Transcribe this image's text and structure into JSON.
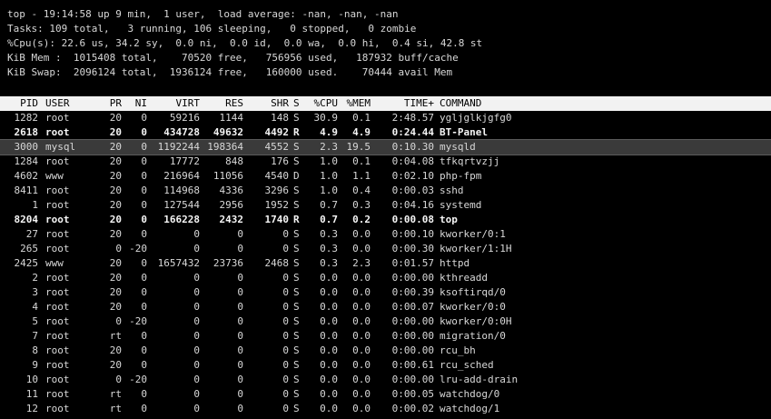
{
  "summary": {
    "line1": "top - 19:14:58 up 9 min,  1 user,  load average: -nan, -nan, -nan",
    "line2": "Tasks: 109 total,   3 running, 106 sleeping,   0 stopped,   0 zombie",
    "line3": "%Cpu(s): 22.6 us, 34.2 sy,  0.0 ni,  0.0 id,  0.0 wa,  0.0 hi,  0.4 si, 42.8 st",
    "line4": "KiB Mem :  1015408 total,    70520 free,   756956 used,   187932 buff/cache",
    "line5": "KiB Swap:  2096124 total,  1936124 free,   160000 used.    70444 avail Mem"
  },
  "columns": {
    "pid": "PID",
    "user": "USER",
    "pr": "PR",
    "ni": "NI",
    "virt": "VIRT",
    "res": "RES",
    "shr": "SHR",
    "s": "S",
    "cpu": "%CPU",
    "mem": "%MEM",
    "time": "TIME+",
    "command": "COMMAND"
  },
  "processes": [
    {
      "pid": "1282",
      "user": "root",
      "pr": "20",
      "ni": "0",
      "virt": "59216",
      "res": "1144",
      "shr": "148",
      "s": "S",
      "cpu": "30.9",
      "mem": "0.1",
      "time": "2:48.57",
      "command": "ygljglkjgfg0",
      "bold": false,
      "selected": false
    },
    {
      "pid": "2618",
      "user": "root",
      "pr": "20",
      "ni": "0",
      "virt": "434728",
      "res": "49632",
      "shr": "4492",
      "s": "R",
      "cpu": "4.9",
      "mem": "4.9",
      "time": "0:24.44",
      "command": "BT-Panel",
      "bold": true,
      "selected": false
    },
    {
      "pid": "3000",
      "user": "mysql",
      "pr": "20",
      "ni": "0",
      "virt": "1192244",
      "res": "198364",
      "shr": "4552",
      "s": "S",
      "cpu": "2.3",
      "mem": "19.5",
      "time": "0:10.30",
      "command": "mysqld",
      "bold": false,
      "selected": true
    },
    {
      "pid": "1284",
      "user": "root",
      "pr": "20",
      "ni": "0",
      "virt": "17772",
      "res": "848",
      "shr": "176",
      "s": "S",
      "cpu": "1.0",
      "mem": "0.1",
      "time": "0:04.08",
      "command": "tfkqrtvzjj",
      "bold": false,
      "selected": false
    },
    {
      "pid": "4602",
      "user": "www",
      "pr": "20",
      "ni": "0",
      "virt": "216964",
      "res": "11056",
      "shr": "4540",
      "s": "D",
      "cpu": "1.0",
      "mem": "1.1",
      "time": "0:02.10",
      "command": "php-fpm",
      "bold": false,
      "selected": false
    },
    {
      "pid": "8411",
      "user": "root",
      "pr": "20",
      "ni": "0",
      "virt": "114968",
      "res": "4336",
      "shr": "3296",
      "s": "S",
      "cpu": "1.0",
      "mem": "0.4",
      "time": "0:00.03",
      "command": "sshd",
      "bold": false,
      "selected": false
    },
    {
      "pid": "1",
      "user": "root",
      "pr": "20",
      "ni": "0",
      "virt": "127544",
      "res": "2956",
      "shr": "1952",
      "s": "S",
      "cpu": "0.7",
      "mem": "0.3",
      "time": "0:04.16",
      "command": "systemd",
      "bold": false,
      "selected": false
    },
    {
      "pid": "8204",
      "user": "root",
      "pr": "20",
      "ni": "0",
      "virt": "166228",
      "res": "2432",
      "shr": "1740",
      "s": "R",
      "cpu": "0.7",
      "mem": "0.2",
      "time": "0:00.08",
      "command": "top",
      "bold": true,
      "selected": false
    },
    {
      "pid": "27",
      "user": "root",
      "pr": "20",
      "ni": "0",
      "virt": "0",
      "res": "0",
      "shr": "0",
      "s": "S",
      "cpu": "0.3",
      "mem": "0.0",
      "time": "0:00.10",
      "command": "kworker/0:1",
      "bold": false,
      "selected": false
    },
    {
      "pid": "265",
      "user": "root",
      "pr": "0",
      "ni": "-20",
      "virt": "0",
      "res": "0",
      "shr": "0",
      "s": "S",
      "cpu": "0.3",
      "mem": "0.0",
      "time": "0:00.30",
      "command": "kworker/1:1H",
      "bold": false,
      "selected": false
    },
    {
      "pid": "2425",
      "user": "www",
      "pr": "20",
      "ni": "0",
      "virt": "1657432",
      "res": "23736",
      "shr": "2468",
      "s": "S",
      "cpu": "0.3",
      "mem": "2.3",
      "time": "0:01.57",
      "command": "httpd",
      "bold": false,
      "selected": false
    },
    {
      "pid": "2",
      "user": "root",
      "pr": "20",
      "ni": "0",
      "virt": "0",
      "res": "0",
      "shr": "0",
      "s": "S",
      "cpu": "0.0",
      "mem": "0.0",
      "time": "0:00.00",
      "command": "kthreadd",
      "bold": false,
      "selected": false
    },
    {
      "pid": "3",
      "user": "root",
      "pr": "20",
      "ni": "0",
      "virt": "0",
      "res": "0",
      "shr": "0",
      "s": "S",
      "cpu": "0.0",
      "mem": "0.0",
      "time": "0:00.39",
      "command": "ksoftirqd/0",
      "bold": false,
      "selected": false
    },
    {
      "pid": "4",
      "user": "root",
      "pr": "20",
      "ni": "0",
      "virt": "0",
      "res": "0",
      "shr": "0",
      "s": "S",
      "cpu": "0.0",
      "mem": "0.0",
      "time": "0:00.07",
      "command": "kworker/0:0",
      "bold": false,
      "selected": false
    },
    {
      "pid": "5",
      "user": "root",
      "pr": "0",
      "ni": "-20",
      "virt": "0",
      "res": "0",
      "shr": "0",
      "s": "S",
      "cpu": "0.0",
      "mem": "0.0",
      "time": "0:00.00",
      "command": "kworker/0:0H",
      "bold": false,
      "selected": false
    },
    {
      "pid": "7",
      "user": "root",
      "pr": "rt",
      "ni": "0",
      "virt": "0",
      "res": "0",
      "shr": "0",
      "s": "S",
      "cpu": "0.0",
      "mem": "0.0",
      "time": "0:00.00",
      "command": "migration/0",
      "bold": false,
      "selected": false
    },
    {
      "pid": "8",
      "user": "root",
      "pr": "20",
      "ni": "0",
      "virt": "0",
      "res": "0",
      "shr": "0",
      "s": "S",
      "cpu": "0.0",
      "mem": "0.0",
      "time": "0:00.00",
      "command": "rcu_bh",
      "bold": false,
      "selected": false
    },
    {
      "pid": "9",
      "user": "root",
      "pr": "20",
      "ni": "0",
      "virt": "0",
      "res": "0",
      "shr": "0",
      "s": "S",
      "cpu": "0.0",
      "mem": "0.0",
      "time": "0:00.61",
      "command": "rcu_sched",
      "bold": false,
      "selected": false
    },
    {
      "pid": "10",
      "user": "root",
      "pr": "0",
      "ni": "-20",
      "virt": "0",
      "res": "0",
      "shr": "0",
      "s": "S",
      "cpu": "0.0",
      "mem": "0.0",
      "time": "0:00.00",
      "command": "lru-add-drain",
      "bold": false,
      "selected": false
    },
    {
      "pid": "11",
      "user": "root",
      "pr": "rt",
      "ni": "0",
      "virt": "0",
      "res": "0",
      "shr": "0",
      "s": "S",
      "cpu": "0.0",
      "mem": "0.0",
      "time": "0:00.05",
      "command": "watchdog/0",
      "bold": false,
      "selected": false
    },
    {
      "pid": "12",
      "user": "root",
      "pr": "rt",
      "ni": "0",
      "virt": "0",
      "res": "0",
      "shr": "0",
      "s": "S",
      "cpu": "0.0",
      "mem": "0.0",
      "time": "0:00.02",
      "command": "watchdog/1",
      "bold": false,
      "selected": false
    }
  ]
}
